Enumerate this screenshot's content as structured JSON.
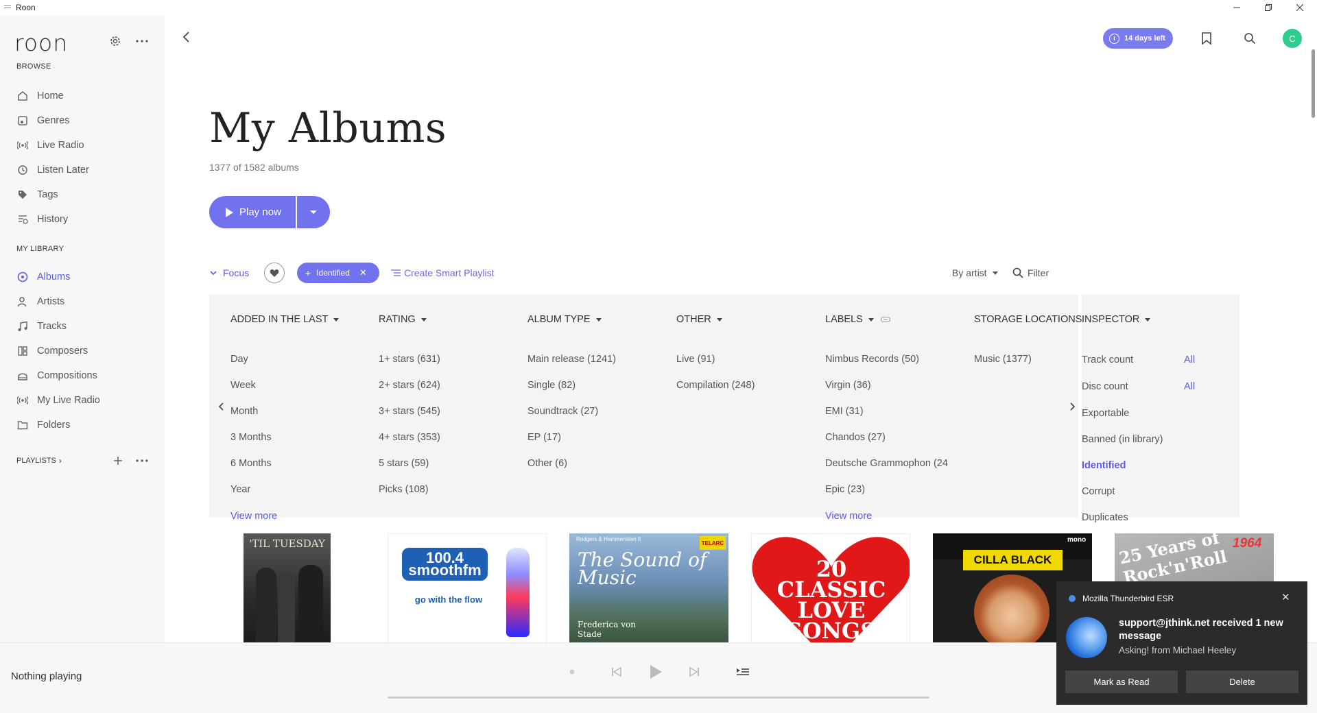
{
  "window": {
    "title": "Roon"
  },
  "sidebar": {
    "browse_label": "BROWSE",
    "browse_items": [
      {
        "label": "Home",
        "icon": "home-icon"
      },
      {
        "label": "Genres",
        "icon": "genres-icon"
      },
      {
        "label": "Live Radio",
        "icon": "radio-icon"
      },
      {
        "label": "Listen Later",
        "icon": "clock-icon"
      },
      {
        "label": "Tags",
        "icon": "tag-icon"
      },
      {
        "label": "History",
        "icon": "history-icon"
      }
    ],
    "library_label": "MY LIBRARY",
    "library_items": [
      {
        "label": "Albums",
        "icon": "album-icon",
        "active": true
      },
      {
        "label": "Artists",
        "icon": "artist-icon"
      },
      {
        "label": "Tracks",
        "icon": "music-note-icon"
      },
      {
        "label": "Composers",
        "icon": "composer-icon"
      },
      {
        "label": "Compositions",
        "icon": "compositions-icon"
      },
      {
        "label": "My Live Radio",
        "icon": "radio-icon"
      },
      {
        "label": "Folders",
        "icon": "folder-icon"
      }
    ],
    "playlists_label": "PLAYLISTS"
  },
  "header": {
    "trial_badge": "14 days left",
    "avatar_initial": "C"
  },
  "page": {
    "title": "My Albums",
    "count": "1377 of 1582 albums",
    "play_now": "Play now"
  },
  "focus": {
    "focus_label": "Focus",
    "active_chip": "Identified",
    "create_smart_playlist": "Create Smart Playlist",
    "sort_label": "By artist",
    "filter_label": "Filter"
  },
  "focus_panel": {
    "columns": [
      {
        "header": "ADDED IN THE LAST",
        "rows": [
          "Day",
          "Week",
          "Month",
          "3 Months",
          "6 Months",
          "Year"
        ],
        "more": "View more"
      },
      {
        "header": "RATING",
        "rows": [
          "1+ stars (631)",
          "2+ stars (624)",
          "3+ stars (545)",
          "4+ stars (353)",
          "5 stars (59)",
          "Picks (108)"
        ]
      },
      {
        "header": "ALBUM TYPE",
        "rows": [
          "Main release (1241)",
          "Single (82)",
          "Soundtrack (27)",
          "EP (17)",
          "Other (6)"
        ]
      },
      {
        "header": "OTHER",
        "rows": [
          "Live (91)",
          "Compilation (248)"
        ]
      },
      {
        "header": "LABELS",
        "rows": [
          "Nimbus Records (50)",
          "Virgin (36)",
          "EMI (31)",
          "Chandos (27)",
          "Deutsche Grammophon (24",
          "Epic (23)"
        ],
        "more": "View more"
      },
      {
        "header": "STORAGE LOCATIONS",
        "rows": [
          "Music (1377)"
        ]
      },
      {
        "header": "INSPECTOR",
        "rows": [
          "Track count",
          "Disc count",
          "Exportable",
          "Banned (in library)",
          "Identified",
          "Corrupt",
          "Duplicates"
        ],
        "all_label": "All"
      }
    ]
  },
  "albums": [
    {
      "cover_text": "'TIL TUESDAY"
    },
    {
      "cover_text": "100.4 smoothfm",
      "sub": "go with the flow"
    },
    {
      "cover_text": "The Sound of Music",
      "sub": "Rodgers & Hammerstein II",
      "badge": "TELARC",
      "artist": "Frederica von Stade"
    },
    {
      "cover_text": "20 CLASSIC LOVE SONGS"
    },
    {
      "cover_text": "CILLA BLACK",
      "badge": "mono"
    },
    {
      "cover_text": "25 Years of Rock'n'Roll",
      "year": "1964"
    }
  ],
  "player": {
    "now_playing": "Nothing playing"
  },
  "toast": {
    "app": "Mozilla Thunderbird ESR",
    "subject": "support@jthink.net received 1 new message",
    "from": "Asking! from Michael Heeley",
    "mark_read": "Mark as Read",
    "delete": "Delete"
  },
  "colors": {
    "accent": "#7272ef",
    "avatar": "#2ecc8f",
    "toast_bg": "#2b2b2b"
  }
}
